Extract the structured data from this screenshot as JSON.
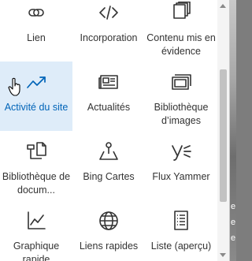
{
  "colors": {
    "icon": "#333333",
    "hover_bg": "#deecf9",
    "hover_text": "#0064b8",
    "label": "#333333"
  },
  "tiles": [
    {
      "label": "Lien",
      "icon": "link-icon"
    },
    {
      "label": "Incorporation",
      "icon": "embed-code-icon"
    },
    {
      "label": "Contenu mis en évidence",
      "icon": "highlighted-content-icon"
    },
    {
      "label": "Activité du site",
      "icon": "trending-line-icon",
      "hovered": true
    },
    {
      "label": "Actualités",
      "icon": "news-icon"
    },
    {
      "label": "Bibliothèque d’images",
      "icon": "image-gallery-icon"
    },
    {
      "label": "Bibliothèque de docum...",
      "icon": "document-library-icon"
    },
    {
      "label": "Bing Cartes",
      "icon": "map-pin-icon"
    },
    {
      "label": "Flux Yammer",
      "icon": "yammer-icon"
    },
    {
      "label": "Graphique rapide",
      "icon": "line-chart-icon"
    },
    {
      "label": "Liens rapides",
      "icon": "globe-icon"
    },
    {
      "label": "Liste (aperçu)",
      "icon": "list-icon"
    }
  ],
  "background_fragments": [
    "e",
    "e",
    "e"
  ]
}
